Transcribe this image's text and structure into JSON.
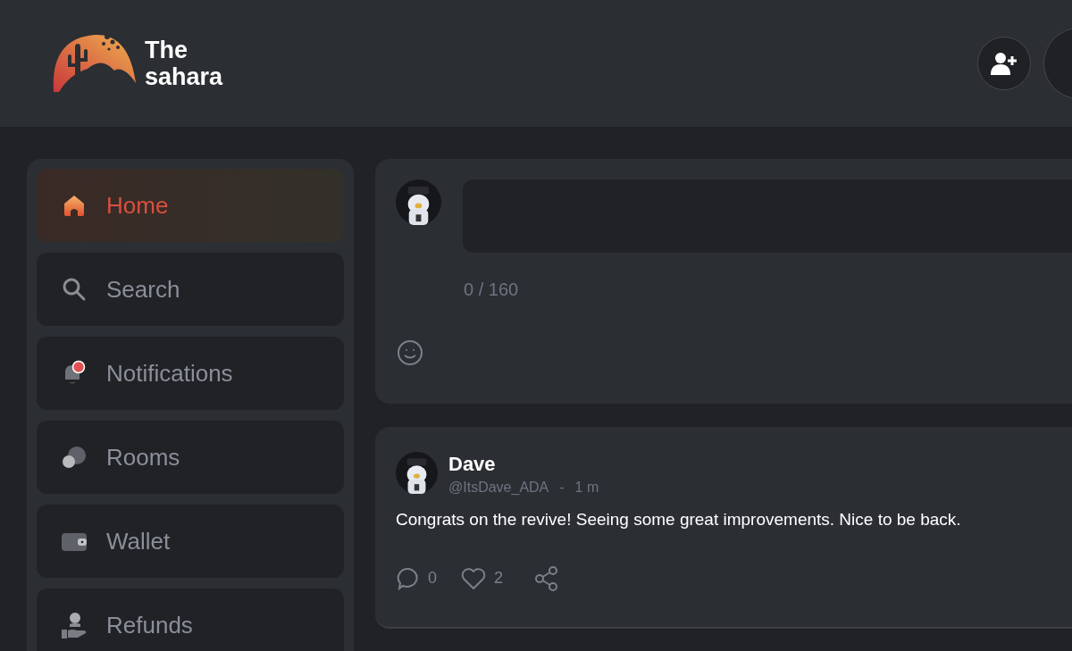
{
  "header": {
    "logo_text": [
      "The",
      "sahara"
    ]
  },
  "sidebar": {
    "items": [
      {
        "label": "Home",
        "kind": "home",
        "selected": true
      },
      {
        "label": "Search",
        "kind": "search",
        "selected": false
      },
      {
        "label": "Notifications",
        "kind": "bell",
        "selected": false,
        "badge": true
      },
      {
        "label": "Rooms",
        "kind": "chat",
        "selected": false
      },
      {
        "label": "Wallet",
        "kind": "wallet",
        "selected": false
      },
      {
        "label": "Refunds",
        "kind": "refund",
        "selected": false
      }
    ]
  },
  "composer": {
    "counter": "0 / 160"
  },
  "posts": [
    {
      "name": "Dave",
      "handle": "@ItsDave_ADA",
      "separator": "-",
      "time": "1 m",
      "text": "Congrats on the revive! Seeing some great improvements. Nice to be back.",
      "comments": "0",
      "likes": "2"
    }
  ]
}
